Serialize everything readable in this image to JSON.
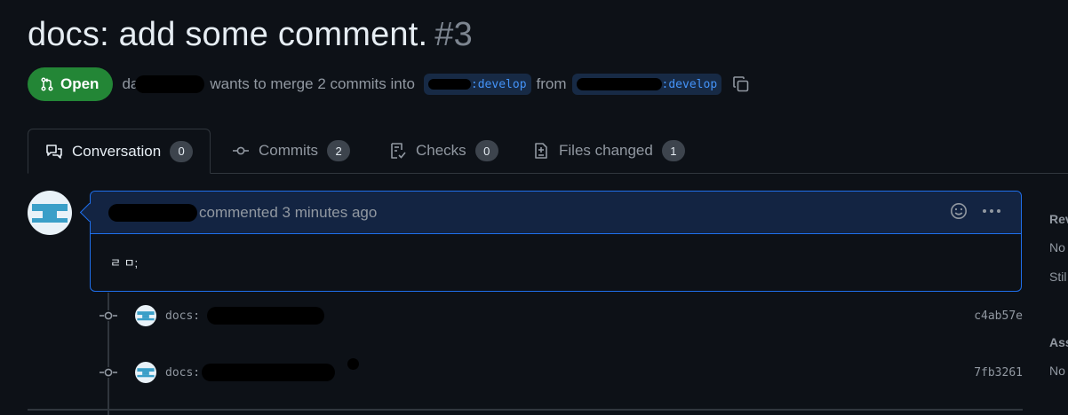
{
  "pr": {
    "title": "docs: add some comment.",
    "number": "#3",
    "state_label": "Open",
    "author_visible": "da",
    "merge_text": "wants to merge 2 commits into",
    "base_branch": ":develop",
    "from_text": "from",
    "head_branch": ":develop"
  },
  "tabs": [
    {
      "label": "Conversation",
      "count": "0",
      "icon": "comment-discussion-icon"
    },
    {
      "label": "Commits",
      "count": "2",
      "icon": "git-commit-icon"
    },
    {
      "label": "Checks",
      "count": "0",
      "icon": "checklist-icon"
    },
    {
      "label": "Files changed",
      "count": "1",
      "icon": "file-diff-icon"
    }
  ],
  "comment": {
    "action_text": "commented 3 minutes ago",
    "body": "ㄹ ㅁ;"
  },
  "commits": [
    {
      "message": "docs:",
      "sha": "c4ab57e"
    },
    {
      "message": "docs:",
      "sha": "7fb3261"
    }
  ],
  "sidebar": {
    "reviewers_label": "Rev",
    "reviewers_value": "No",
    "reviewers_value2": "Stil",
    "assignees_label": "Ass",
    "assignees_value": "No"
  },
  "colors": {
    "background": "#0d1117",
    "open_badge": "#238636",
    "branch_text": "#4493f8",
    "comment_border": "#1f6feb",
    "comment_header": "#132442"
  }
}
